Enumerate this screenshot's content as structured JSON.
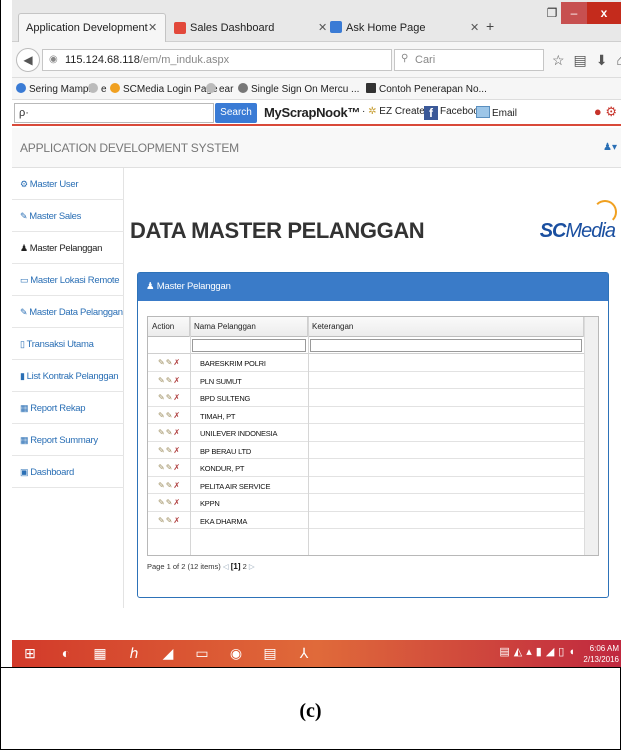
{
  "browser": {
    "tabs": [
      {
        "label": "Application Development",
        "active": true
      },
      {
        "label": "Sales Dashboard",
        "active": false
      },
      {
        "label": "Ask Home Page",
        "active": false
      }
    ],
    "url_host": "115.124.68.118",
    "url_path": "/em/m_induk.aspx",
    "search_placeholder": "Cari",
    "bookmarks": [
      "Sering Mampir",
      "e",
      "SCMedia Login Page",
      "ear",
      "Single Sign On Mercu ...",
      "Contoh Penerapan No..."
    ],
    "toolbar": {
      "search_label": "Search",
      "brand": "MyScrapNook™",
      "items": [
        "EZ Create",
        "Facebook",
        "Email"
      ]
    }
  },
  "app": {
    "title": "APPLICATION DEVELOPMENT SYSTEM",
    "sidebar": [
      {
        "icon": "gear-icon",
        "label": "Master User"
      },
      {
        "icon": "edit-icon",
        "label": "Master Sales"
      },
      {
        "icon": "user-icon",
        "label": "Master Pelanggan"
      },
      {
        "icon": "monitor-icon",
        "label": "Master Lokasi Remote"
      },
      {
        "icon": "edit-icon",
        "label": "Master Data Pelanggan Sales"
      },
      {
        "icon": "file-icon",
        "label": "Transaksi Utama"
      },
      {
        "icon": "bookmark-icon",
        "label": "List Kontrak Pelanggan"
      },
      {
        "icon": "table-icon",
        "label": "Report Rekap"
      },
      {
        "icon": "table-icon",
        "label": "Report Summary"
      },
      {
        "icon": "picture-icon",
        "label": "Dashboard"
      }
    ],
    "page_title": "DATA MASTER PELANGGAN",
    "logo": {
      "sc": "SC",
      "media": "Media"
    },
    "panel_title": "Master Pelanggan",
    "grid": {
      "columns": [
        "Action",
        "Nama Pelanggan",
        "Keterangan"
      ],
      "rows": [
        "BARESKRIM POLRI",
        "PLN SUMUT",
        "BPD SULTENG",
        "TIMAH, PT",
        "UNILEVER INDONESIA",
        "BP BERAU LTD",
        "KONDUR, PT",
        "PELITA AIR SERVICE",
        "KPPN",
        "EKA DHARMA"
      ]
    },
    "pager": {
      "summary": "Page 1 of 2 (12 items)",
      "current": "[1]",
      "next": "2"
    }
  },
  "taskbar": {
    "time": "6:06 AM",
    "date": "2/13/2016"
  },
  "caption": "(c)"
}
